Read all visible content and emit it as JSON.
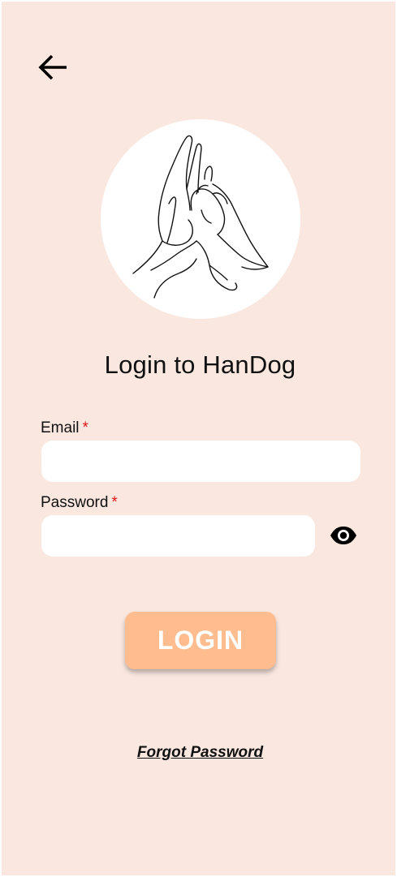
{
  "app": {
    "title": "Login to HanDog",
    "background_color": "#fae8e0",
    "accent_color": "#ffbc8e",
    "required_color": "#e01818"
  },
  "header": {
    "back_icon": "arrow-left-icon"
  },
  "logo": {
    "icon": "dog-paw-high-five-hand-illustration"
  },
  "form": {
    "email": {
      "label": "Email",
      "required_marker": "*",
      "value": ""
    },
    "password": {
      "label": "Password",
      "required_marker": "*",
      "value": "",
      "toggle_icon": "eye-icon"
    },
    "login_label": "LOGIN",
    "forgot_label": "Forgot Password"
  }
}
